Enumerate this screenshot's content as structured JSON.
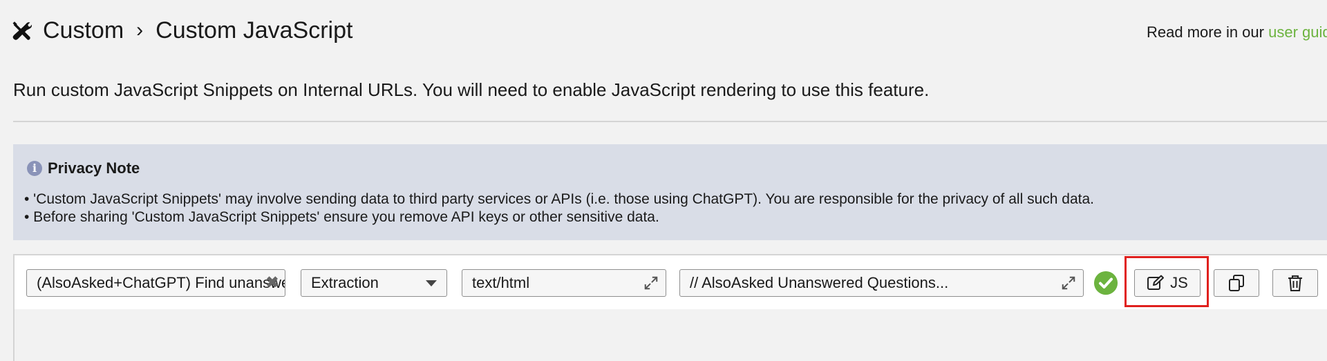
{
  "header": {
    "icon": "tools-icon",
    "breadcrumb": [
      "Custom",
      "Custom JavaScript"
    ],
    "separator": "›",
    "guide_prefix": "Read more in our ",
    "guide_link": "user guide"
  },
  "description": "Run custom JavaScript Snippets on Internal URLs. You will need to enable JavaScript rendering to use this feature.",
  "privacy_note": {
    "icon": "info-icon",
    "icon_glyph": "i",
    "title": "Privacy Note",
    "lines": [
      "• 'Custom JavaScript Snippets' may involve sending data to third party services or APIs (i.e. those using ChatGPT). You are responsible for the privacy of all such data.",
      "• Before sharing 'Custom JavaScript Snippets' ensure you remove API keys or other sensitive data."
    ]
  },
  "snippet_row": {
    "name_value": "(AlsoAsked+ChatGPT) Find unanswered questions",
    "type_value": "Extraction",
    "content_type_value": "text/html",
    "code_preview": "// AlsoAsked Unanswered Questions...",
    "status_icon": "check-circle-icon",
    "edit_button_label": "JS",
    "edit_icon": "edit-icon",
    "copy_icon": "copy-icon",
    "delete_icon": "trash-icon"
  },
  "colors": {
    "link": "#6cb33f",
    "note_background": "#d9dde7",
    "status_ok": "#6cb33f",
    "highlight": "#e0201d"
  }
}
